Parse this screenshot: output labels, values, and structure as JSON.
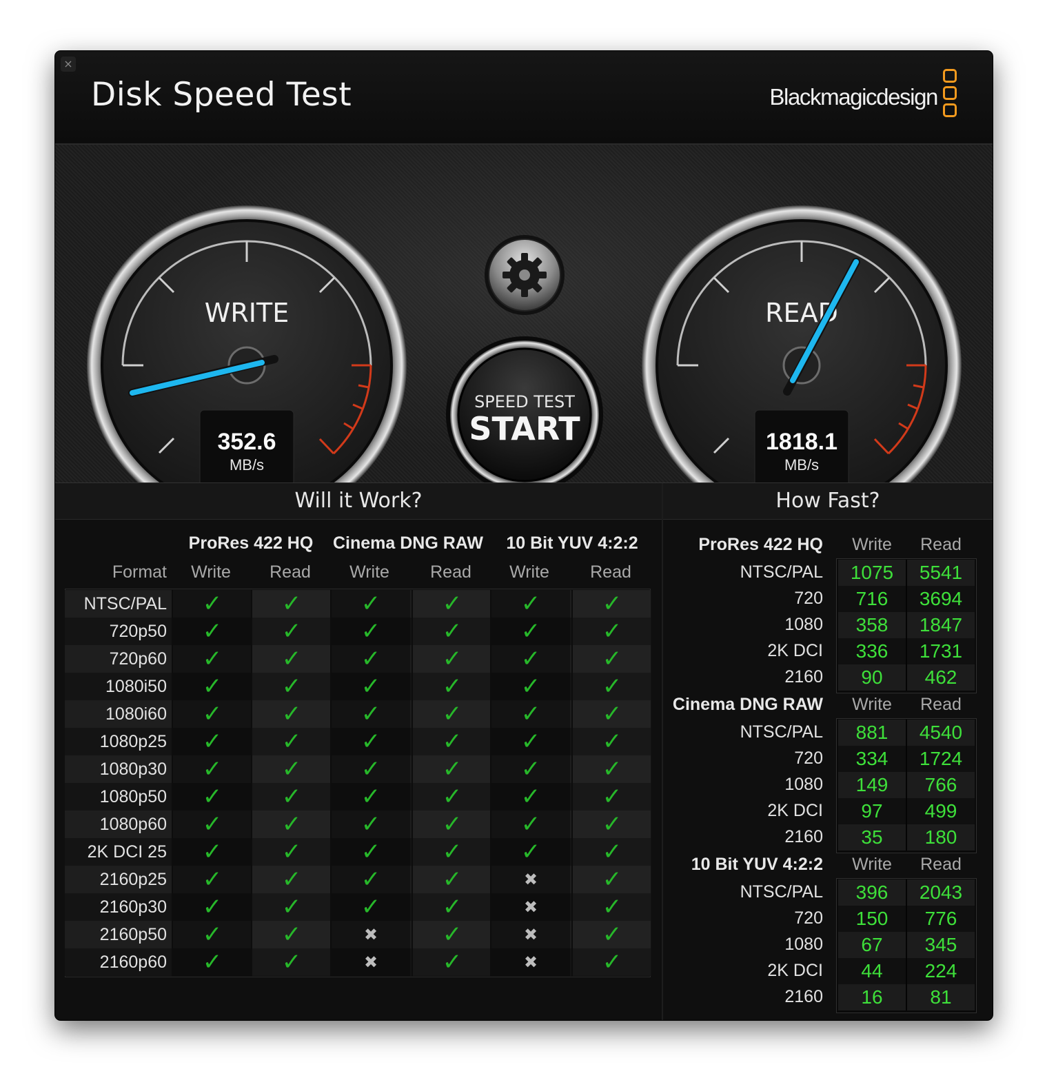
{
  "window": {
    "title": "Disk Speed Test",
    "brand": "Blackmagicdesign",
    "close_icon": "×"
  },
  "gauges": {
    "write": {
      "label": "WRITE",
      "value": "352.6",
      "unit": "MB/s",
      "needle_color": "#1eb7ef"
    },
    "read": {
      "label": "READ",
      "value": "1818.1",
      "unit": "MB/s",
      "needle_color": "#1eb7ef"
    },
    "settings_icon": "gear-icon",
    "start_button": {
      "line1": "SPEED TEST",
      "line2": "START"
    }
  },
  "will_it_work": {
    "title": "Will it Work?",
    "format_label": "Format",
    "groups": [
      "ProRes 422 HQ",
      "Cinema DNG RAW",
      "10 Bit YUV 4:2:2"
    ],
    "subcols": [
      "Write",
      "Read",
      "Write",
      "Read",
      "Write",
      "Read"
    ],
    "rows": [
      {
        "format": "NTSC/PAL",
        "results": [
          1,
          1,
          1,
          1,
          1,
          1
        ]
      },
      {
        "format": "720p50",
        "results": [
          1,
          1,
          1,
          1,
          1,
          1
        ]
      },
      {
        "format": "720p60",
        "results": [
          1,
          1,
          1,
          1,
          1,
          1
        ]
      },
      {
        "format": "1080i50",
        "results": [
          1,
          1,
          1,
          1,
          1,
          1
        ]
      },
      {
        "format": "1080i60",
        "results": [
          1,
          1,
          1,
          1,
          1,
          1
        ]
      },
      {
        "format": "1080p25",
        "results": [
          1,
          1,
          1,
          1,
          1,
          1
        ]
      },
      {
        "format": "1080p30",
        "results": [
          1,
          1,
          1,
          1,
          1,
          1
        ]
      },
      {
        "format": "1080p50",
        "results": [
          1,
          1,
          1,
          1,
          1,
          1
        ]
      },
      {
        "format": "1080p60",
        "results": [
          1,
          1,
          1,
          1,
          1,
          1
        ]
      },
      {
        "format": "2K DCI 25",
        "results": [
          1,
          1,
          1,
          1,
          1,
          1
        ]
      },
      {
        "format": "2160p25",
        "results": [
          1,
          1,
          1,
          1,
          0,
          1
        ]
      },
      {
        "format": "2160p30",
        "results": [
          1,
          1,
          1,
          1,
          0,
          1
        ]
      },
      {
        "format": "2160p50",
        "results": [
          1,
          1,
          0,
          1,
          0,
          1
        ]
      },
      {
        "format": "2160p60",
        "results": [
          1,
          1,
          0,
          1,
          0,
          1
        ]
      }
    ],
    "check_glyph": "✓",
    "cross_glyph": "✖"
  },
  "how_fast": {
    "title": "How Fast?",
    "col_write": "Write",
    "col_read": "Read",
    "groups": [
      {
        "name": "ProRes 422 HQ",
        "rows": [
          {
            "label": "NTSC/PAL",
            "write": "1075",
            "read": "5541"
          },
          {
            "label": "720",
            "write": "716",
            "read": "3694"
          },
          {
            "label": "1080",
            "write": "358",
            "read": "1847"
          },
          {
            "label": "2K DCI",
            "write": "336",
            "read": "1731"
          },
          {
            "label": "2160",
            "write": "90",
            "read": "462"
          }
        ]
      },
      {
        "name": "Cinema DNG RAW",
        "rows": [
          {
            "label": "NTSC/PAL",
            "write": "881",
            "read": "4540"
          },
          {
            "label": "720",
            "write": "334",
            "read": "1724"
          },
          {
            "label": "1080",
            "write": "149",
            "read": "766"
          },
          {
            "label": "2K DCI",
            "write": "97",
            "read": "499"
          },
          {
            "label": "2160",
            "write": "35",
            "read": "180"
          }
        ]
      },
      {
        "name": "10 Bit YUV 4:2:2",
        "rows": [
          {
            "label": "NTSC/PAL",
            "write": "396",
            "read": "2043"
          },
          {
            "label": "720",
            "write": "150",
            "read": "776"
          },
          {
            "label": "1080",
            "write": "67",
            "read": "345"
          },
          {
            "label": "2K DCI",
            "write": "44",
            "read": "224"
          },
          {
            "label": "2160",
            "write": "16",
            "read": "81"
          }
        ]
      }
    ]
  }
}
